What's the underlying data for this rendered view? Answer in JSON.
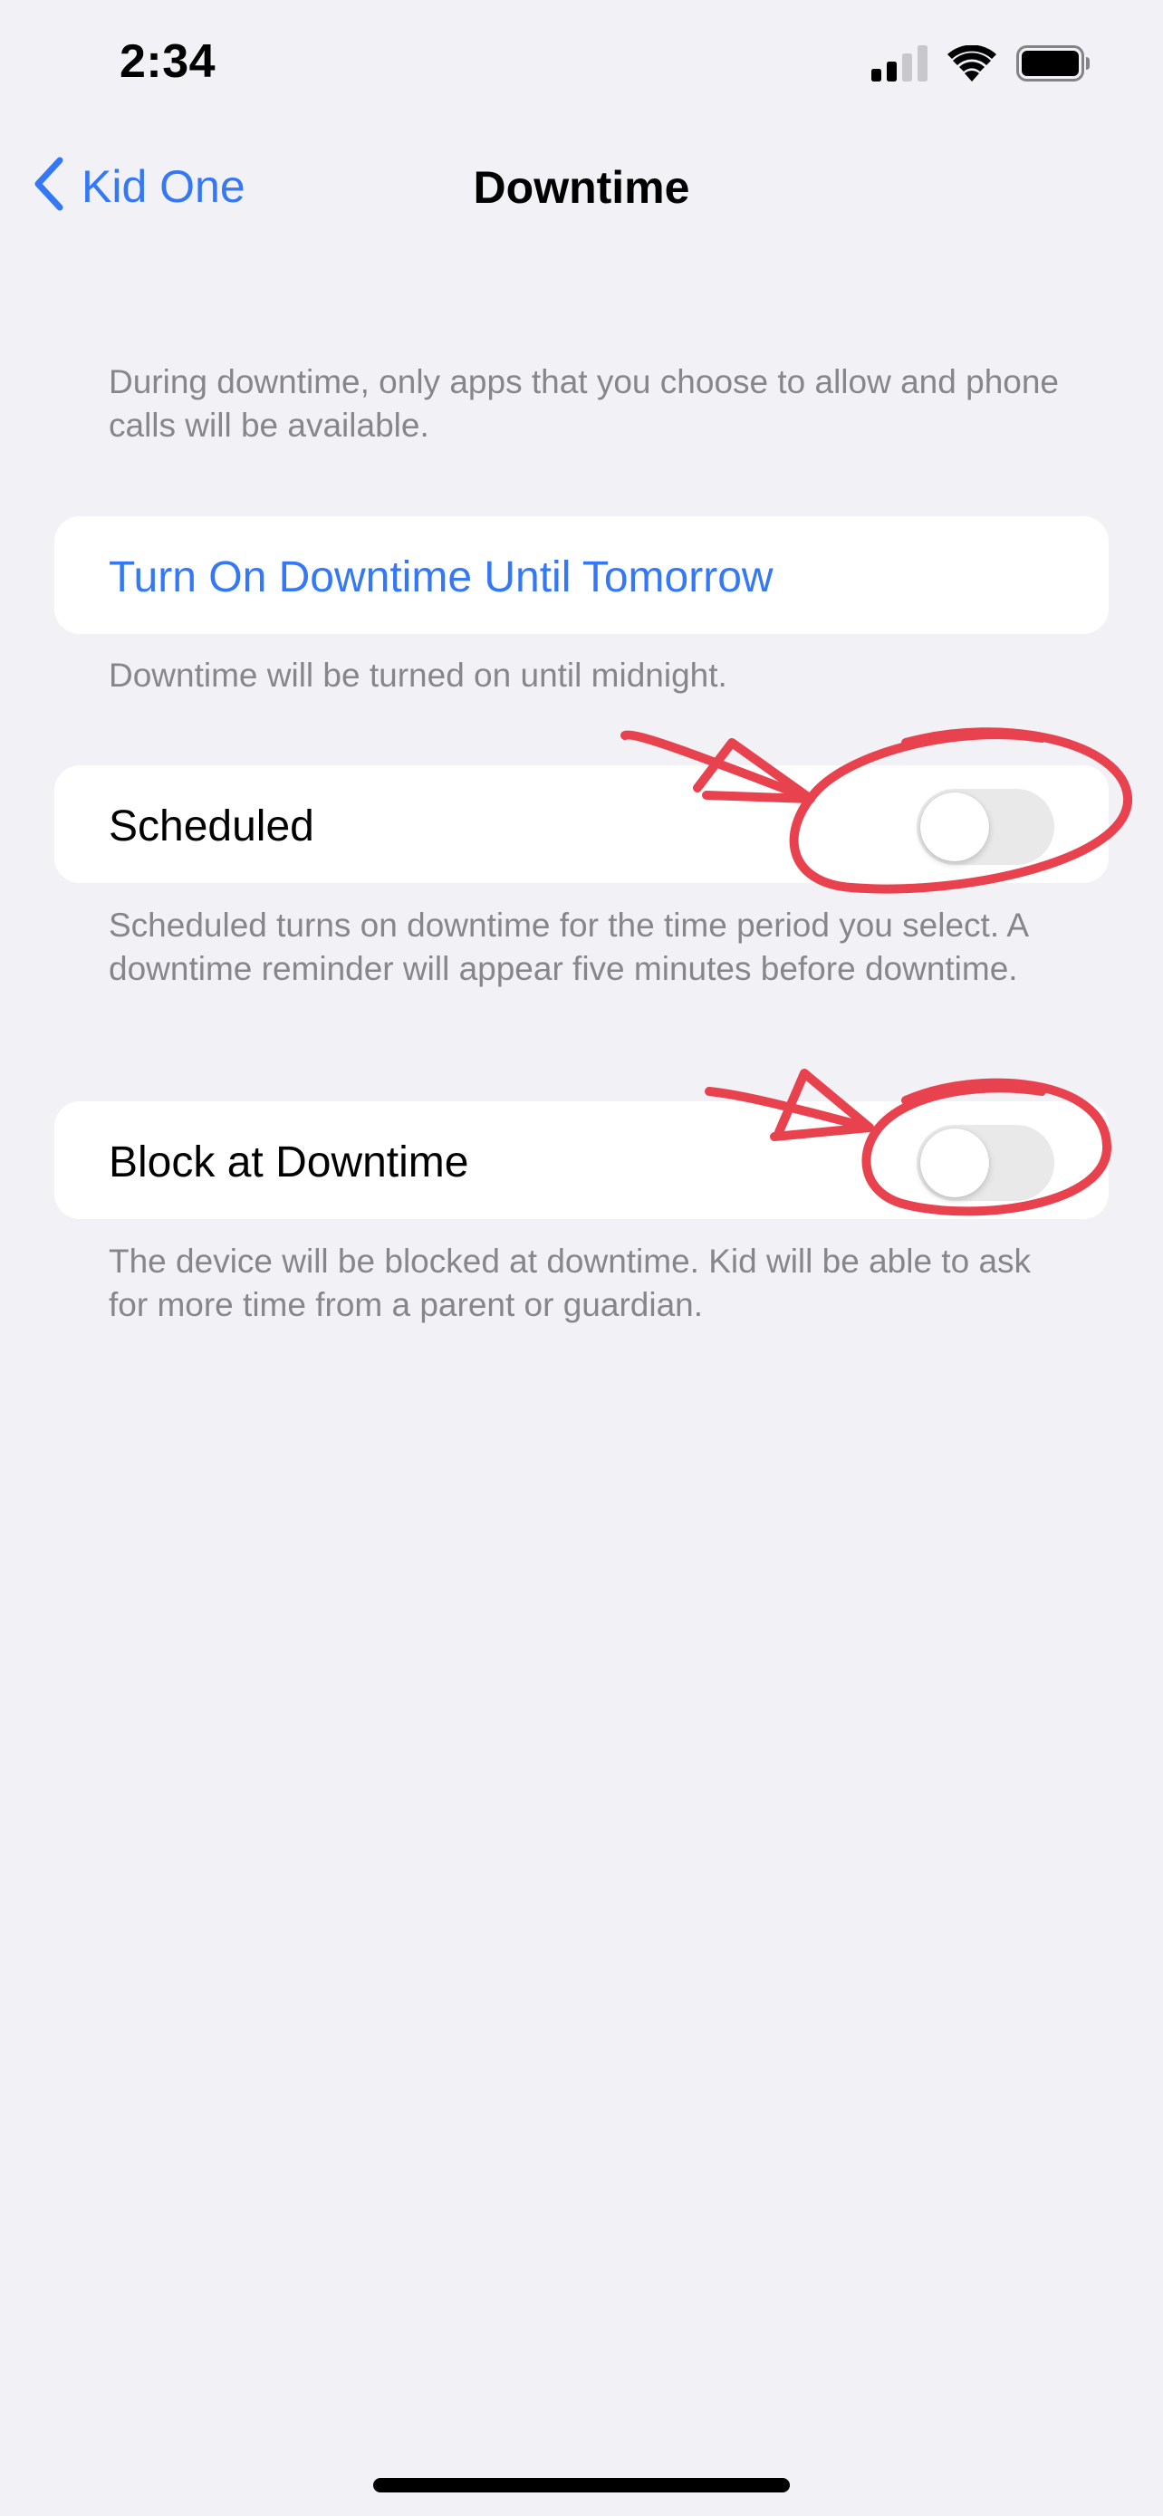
{
  "status_bar": {
    "time": "2:34",
    "icons": [
      "cellular-signal-icon",
      "wifi-icon",
      "battery-icon"
    ]
  },
  "nav": {
    "back_label": "Kid One",
    "title": "Downtime"
  },
  "intro_text": "During downtime, only apps that you choose to allow and phone calls will be available.",
  "sections": {
    "turn_on": {
      "label": "Turn On Downtime Until Tomorrow",
      "footer": "Downtime will be turned on until midnight."
    },
    "scheduled": {
      "label": "Scheduled",
      "enabled": false,
      "footer": "Scheduled turns on downtime for the time period you select. A downtime reminder will appear five minutes before downtime."
    },
    "block": {
      "label": "Block at Downtime",
      "enabled": false,
      "footer": "The device will be blocked at downtime. Kid will be able to ask for more time from a parent or guardian."
    }
  },
  "colors": {
    "accent": "#3478f6",
    "background": "#f1f1f6",
    "secondary_text": "#86868b",
    "toggle_off": "#e9e9ea",
    "annotation": "#e8424f"
  }
}
